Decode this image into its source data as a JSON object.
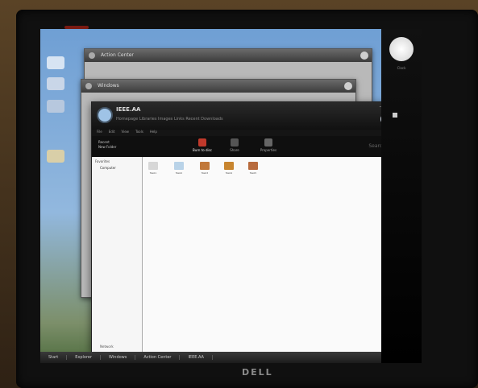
{
  "monitor": {
    "brand": "DELL"
  },
  "desktop": {
    "icons": [
      "icon-1",
      "icon-2",
      "icon-3",
      "icon-4"
    ]
  },
  "background_windows": [
    {
      "title": "Action Center"
    },
    {
      "title": "Windows"
    }
  ],
  "app": {
    "name": "IEEE.AA",
    "subtitle": "Homepage   Libraries   Images   Links   Recent   Downloads",
    "menu": [
      "File",
      "Edit",
      "View",
      "Tools",
      "Help"
    ],
    "toolbar": {
      "left_lines": [
        "Recent",
        "New Folder"
      ],
      "buttons": [
        {
          "label": "Burn to disc"
        },
        {
          "label": "Share"
        },
        {
          "label": "Properties"
        }
      ],
      "search": "Search"
    },
    "sidebar": {
      "header": "Favorites",
      "items": [
        "Computer"
      ],
      "footer": "Network"
    },
    "files": [
      {
        "top": "",
        "caption": "file01",
        "color": "#d7d7d7"
      },
      {
        "top": "",
        "caption": "file02",
        "color": "#b9d3e8"
      },
      {
        "top": "",
        "caption": "file03",
        "color": "#c1783a"
      },
      {
        "top": "",
        "caption": "file04",
        "color": "#c8852f"
      },
      {
        "top": "",
        "caption": "file05",
        "color": "#b86b3d"
      }
    ]
  },
  "taskbar": {
    "items": [
      "Start",
      "Explorer",
      "Windows",
      "Action Center",
      "IEEE.AA"
    ]
  },
  "gadgets": {
    "clock_label": "Clock"
  }
}
